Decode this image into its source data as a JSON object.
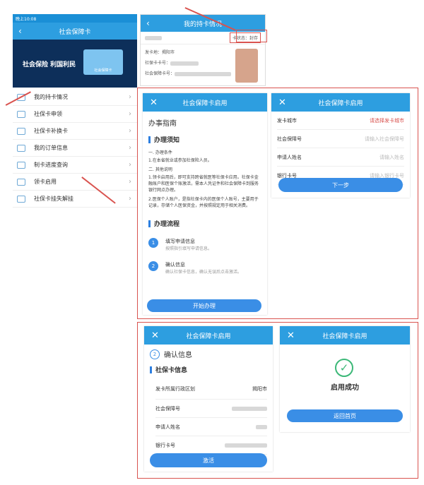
{
  "phone1": {
    "status_time": "晚上10:08",
    "title": "社会保障卡",
    "banner": "社会保险 利国利民",
    "card_tag": "社会保障卡",
    "menu": [
      "我的持卡情况",
      "社保卡申领",
      "社保卡补换卡",
      "我的订单信息",
      "制卡进度查询",
      "领卡启用",
      "社保卡挂失解挂"
    ]
  },
  "phone2": {
    "title": "我的持卡情况",
    "status": "卡状态：封存",
    "issue_place_label": "发卡地：",
    "issue_place": "揭阳市",
    "card_no_label": "社保卡卡号：",
    "bank_label": "社会保障卡号："
  },
  "guide": {
    "title": "社会保障卡启用",
    "heading": "办事指南",
    "notice": "办理须知",
    "items": [
      "一. 办理条件",
      "1.在本省就业或参加社保险人员。",
      "二. 其他说明",
      "1.领卡启用后，即可支持跨省就医等社保卡应用。社保卡金融账户和医保个账激活，需本人凭证件和社会保障卡到服务银行网点办理。",
      "2.医保个人账户，是指社保卡内的医保个人账号，主要用于记录，存储个人医保资金，并按照规定用于相关消费。"
    ],
    "flow": "办理流程",
    "steps": [
      {
        "n": "1",
        "t": "填写申请信息",
        "s": "按照指引填写申请信息。"
      },
      {
        "n": "2",
        "t": "确认信息",
        "s": "确认社保卡信息，确认无误后点击激活。"
      }
    ],
    "button": "开始办理"
  },
  "form": {
    "title": "社会保障卡启用",
    "rows": [
      {
        "l": "发卡城市",
        "v": "请选择发卡城市"
      },
      {
        "l": "社会保障号",
        "v": "请输入社会保障号"
      },
      {
        "l": "申请人姓名",
        "v": "请输入姓名"
      },
      {
        "l": "银行卡号",
        "v": "请输入银行卡号"
      }
    ],
    "button": "下一步"
  },
  "confirm": {
    "title": "社会保障卡启用",
    "step_num": "2",
    "step": "确认信息",
    "section": "社保卡信息",
    "rows": [
      {
        "l": "发卡所属行政区划",
        "v": "揭阳市"
      },
      {
        "l": "社会保障号",
        "v": ""
      },
      {
        "l": "申请人姓名",
        "v": ""
      },
      {
        "l": "银行卡号",
        "v": ""
      }
    ],
    "button": "激活"
  },
  "success": {
    "title": "社会保障卡启用",
    "message": "启用成功",
    "button": "返回首页"
  },
  "colors": {
    "accent": "#2d9ee0",
    "button": "#3a8ee6",
    "highlight": "#d9534f"
  }
}
